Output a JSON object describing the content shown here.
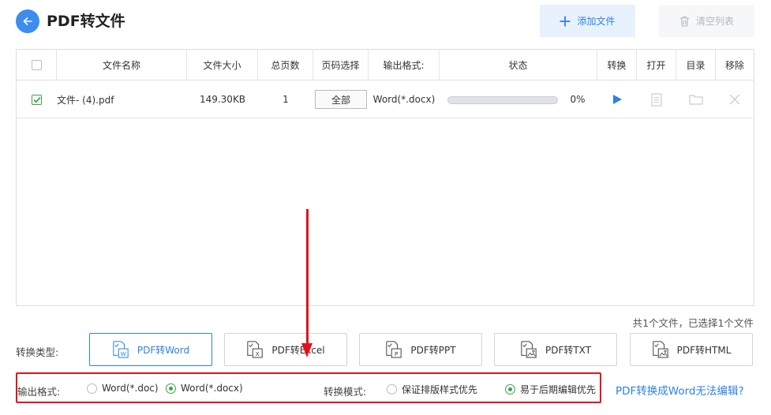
{
  "header": {
    "title": "PDF转文件",
    "add_label": "添加文件",
    "clear_label": "清空列表"
  },
  "table": {
    "columns": [
      "文件名称",
      "文件大小",
      "总页数",
      "页码选择",
      "输出格式:",
      "状态",
      "转换",
      "打开",
      "目录",
      "移除"
    ],
    "rows": [
      {
        "name": "文件- (4).pdf",
        "size": "149.30KB",
        "pages": "1",
        "page_select": "全部",
        "format": "Word(*.docx)",
        "progress": 0,
        "progress_text": "0%"
      }
    ]
  },
  "summary": "共1个文件，已选择1个文件",
  "convert_type": {
    "label": "转换类型:",
    "options": [
      "PDF转Word",
      "PDF转Excel",
      "PDF转PPT",
      "PDF转TXT",
      "PDF转HTML"
    ],
    "selected": "PDF转Word"
  },
  "output_format": {
    "label": "输出格式:",
    "options": [
      "Word(*.doc)",
      "Word(*.docx)"
    ],
    "selected": "Word(*.docx)"
  },
  "convert_mode": {
    "label": "转换模式:",
    "options": [
      "保证排版样式优先",
      "易于后期编辑优先"
    ],
    "selected": "易于后期编辑优先"
  },
  "help_link": "PDF转换成Word无法编辑?",
  "colors": {
    "accent": "#2f80e8",
    "check_green": "#3aa34a",
    "annotation_red": "#e0141e"
  }
}
